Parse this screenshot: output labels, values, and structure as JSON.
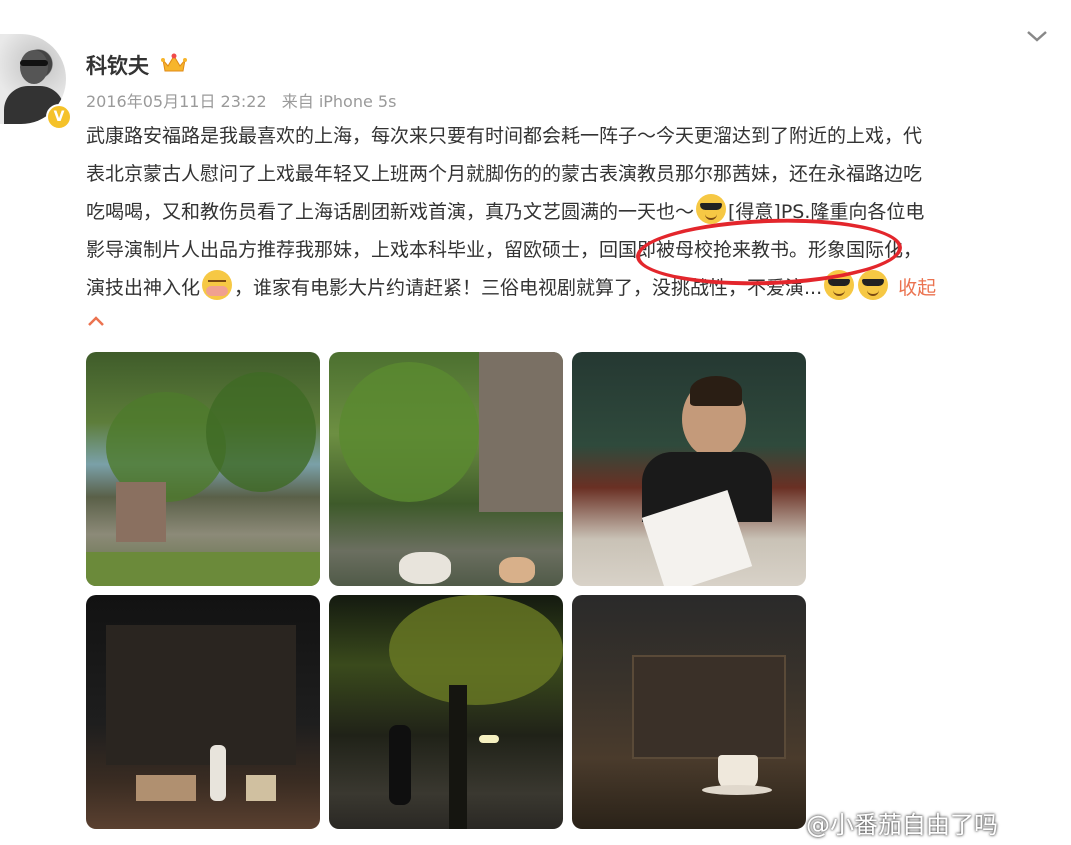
{
  "user": {
    "name": "科钦夫"
  },
  "post": {
    "date": "2016年05月11日 23:22",
    "source": "来自 iPhone 5s",
    "lines": [
      "武康路安福路是我最喜欢的上海，每次来只要有时间都会耗一阵子～今天更溜达到了附近的上戏，代",
      "表北京蒙古人慰问了上戏最年轻又上班两个月就脚伤的的蒙古表演教员那尔那茜妹，还在永福路边吃",
      "吃喝喝，又和教伤员看了上海话剧团新戏首演，真乃文艺圆满的一天也～"
    ],
    "line3_tail": "[得意]PS.隆重向各位电",
    "line4": "影导演制片人出品方推荐我那妹，上戏本科毕业，留欧硕士，回国即被母校抢来教书。形象国际化，",
    "line5_a": "演技出神入化",
    "line5_b": "，谁家有电影大片约请赶紧！三俗电视剧就算了，没挑战性，不爱演...",
    "collapse_label": "收起"
  },
  "photos": [
    {
      "icon": "street-trees-photo"
    },
    {
      "icon": "cats-under-tree-photo"
    },
    {
      "icon": "woman-reading-papers-photo"
    },
    {
      "icon": "stage-performance-photo"
    },
    {
      "icon": "night-street-photo"
    },
    {
      "icon": "cafe-window-coffee-photo"
    }
  ],
  "watermark": "@小番茄自由了吗",
  "colors": {
    "link": "#eb7350",
    "highlight": "#e3262c",
    "meta": "#9a9a9a"
  }
}
